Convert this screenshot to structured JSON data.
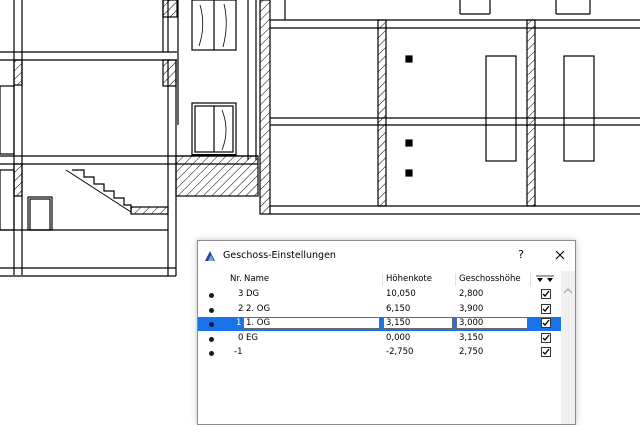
{
  "dialog": {
    "title": "Geschoss-Einstellungen",
    "help_label": "?",
    "close_icon": "close-icon",
    "app_icon": "archicad-icon"
  },
  "table": {
    "headers": {
      "nr": "Nr.",
      "name": "Name",
      "elevation": "Höhenkote",
      "height": "Geschosshöhe",
      "options": "filter-arrows-icon"
    },
    "rows": [
      {
        "nr": "3",
        "name": "DG",
        "elevation": "10,050",
        "height": "2,800",
        "checked": true,
        "selected": false
      },
      {
        "nr": "2",
        "name": "2. OG",
        "elevation": "6,150",
        "height": "3,900",
        "checked": true,
        "selected": false
      },
      {
        "nr": "1",
        "name": "1. OG",
        "elevation": "3,150",
        "height": "3,000",
        "checked": true,
        "selected": true
      },
      {
        "nr": "0",
        "name": "EG",
        "elevation": "0,000",
        "height": "3,150",
        "checked": true,
        "selected": false
      },
      {
        "nr": "-1",
        "name": "",
        "elevation": "-2,750",
        "height": "2,750",
        "checked": true,
        "selected": false
      }
    ]
  },
  "colors": {
    "selection": "#1a73e8",
    "wall_line": "#000000",
    "window_frame": "#000000"
  }
}
